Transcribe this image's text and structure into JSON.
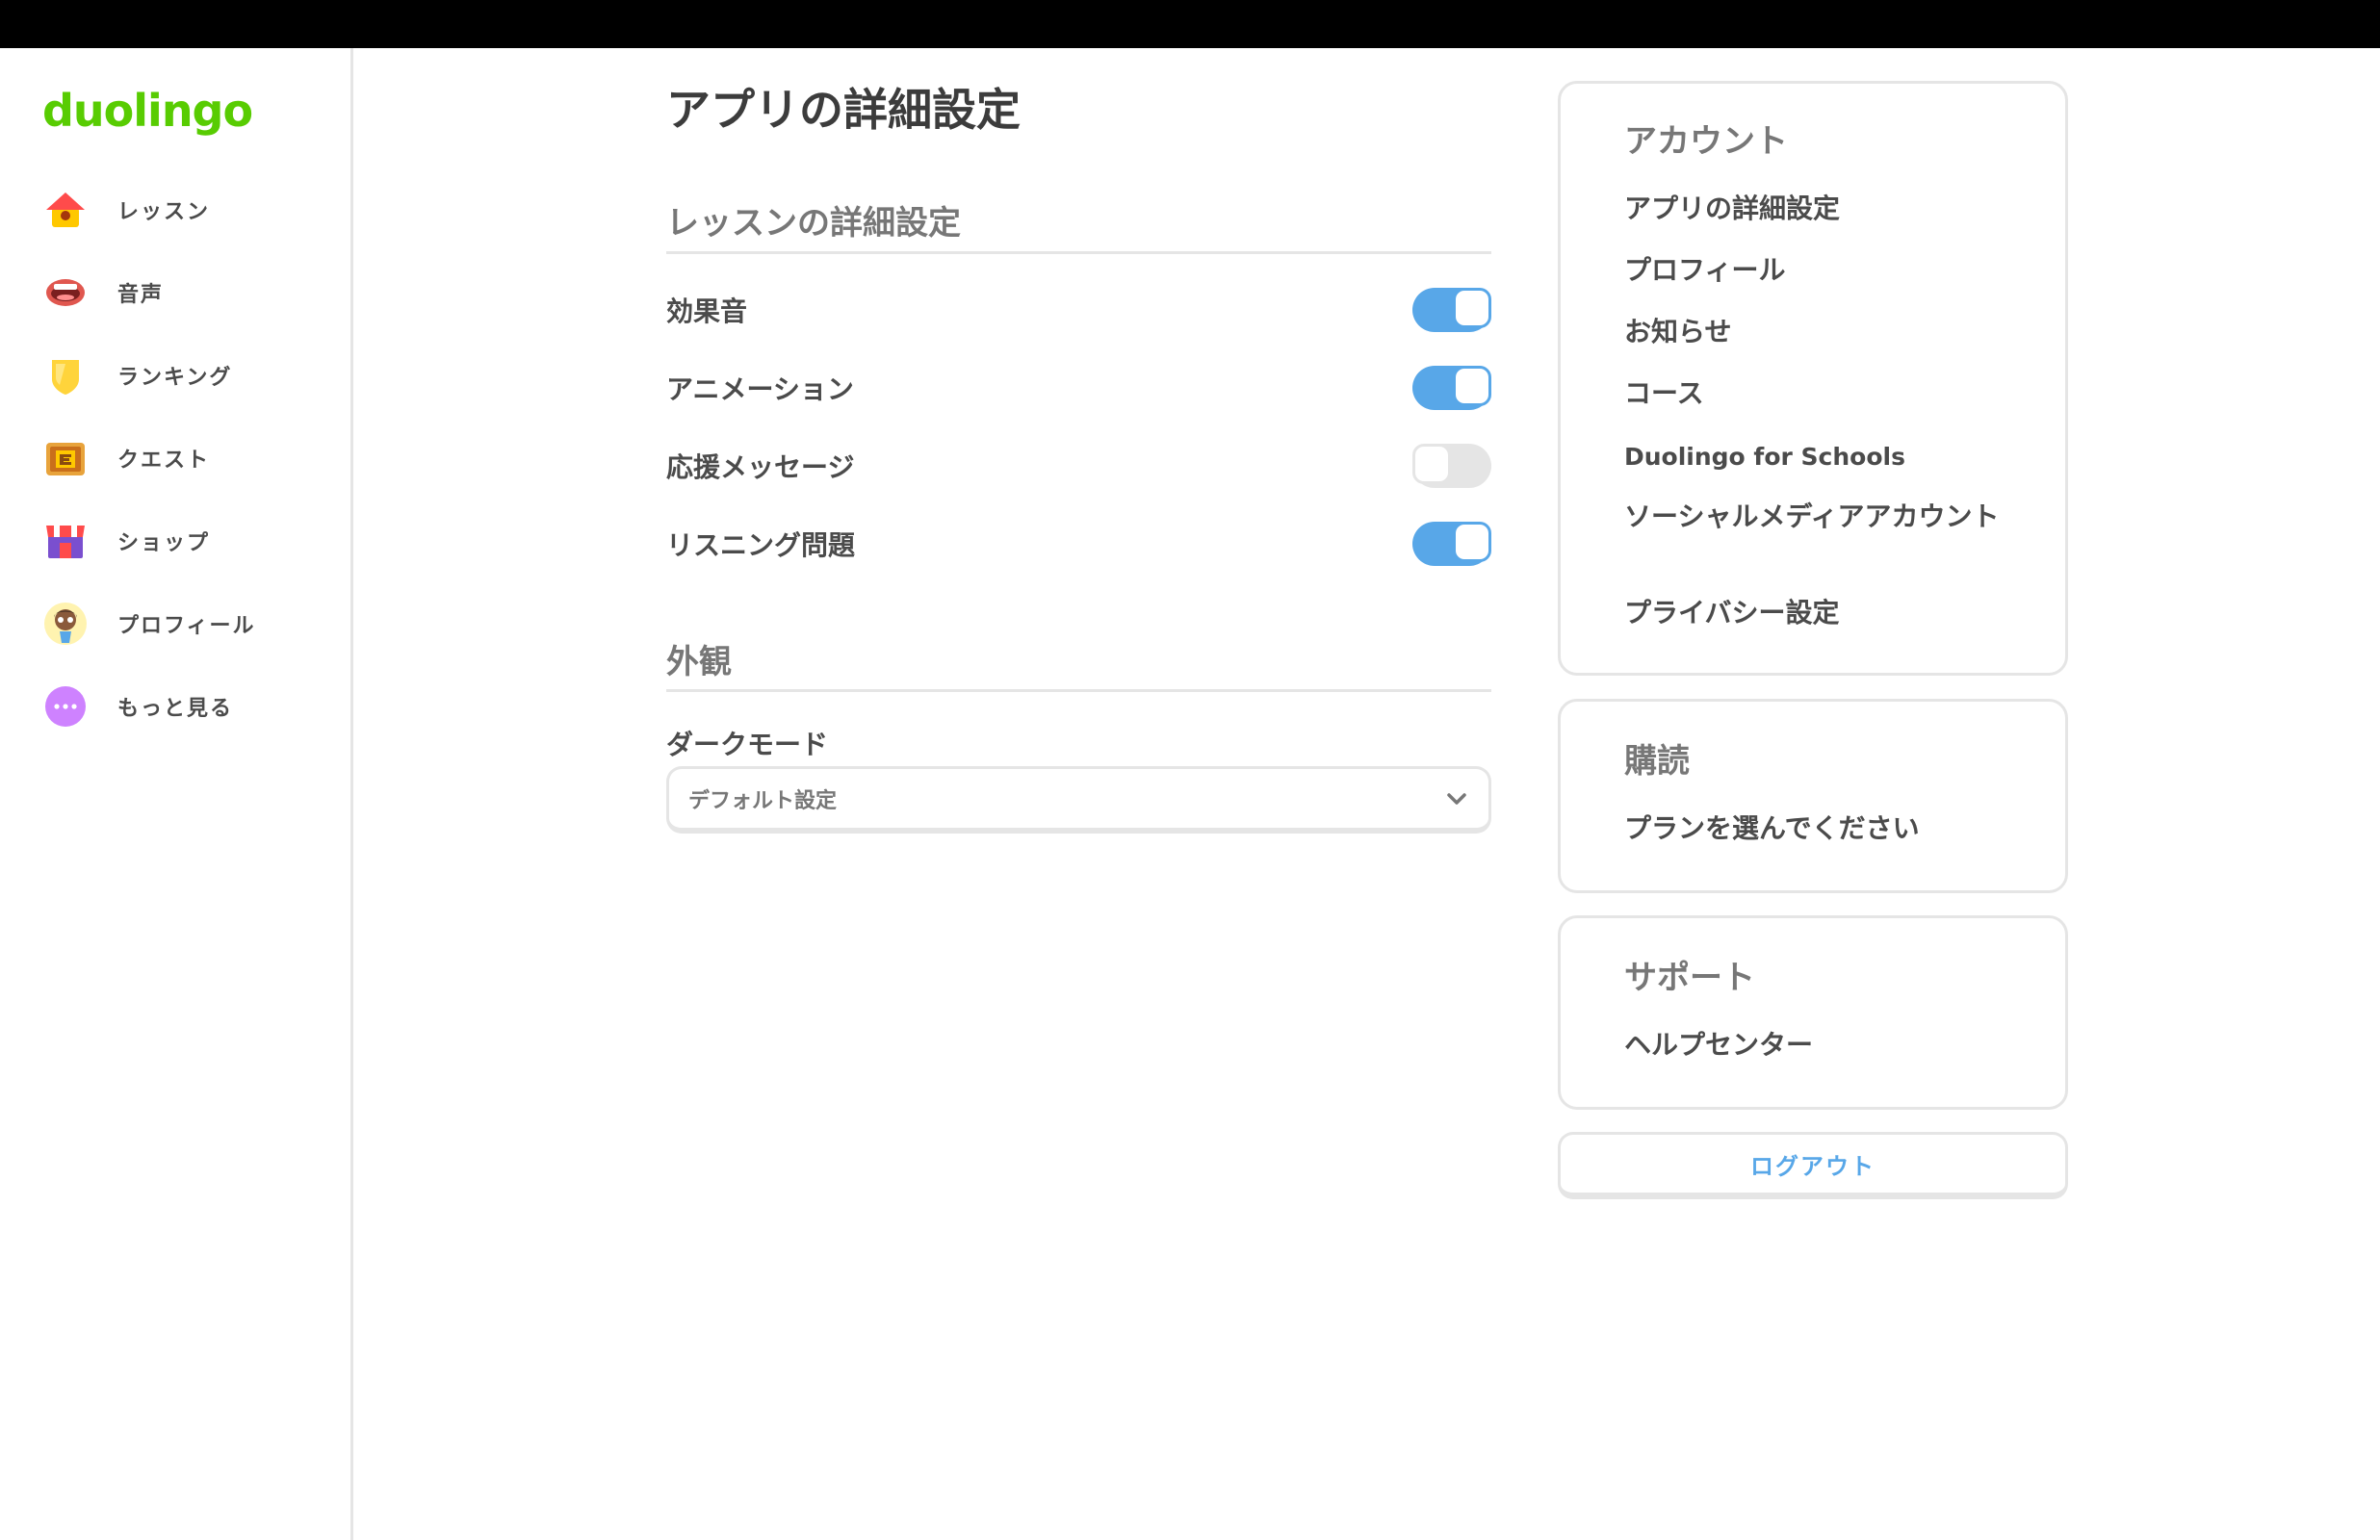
{
  "app": {
    "logo_text": "duolingo"
  },
  "sidebar": {
    "items": [
      {
        "label": "レッスン",
        "icon": "home-icon"
      },
      {
        "label": "音声",
        "icon": "mouth-icon"
      },
      {
        "label": "ランキング",
        "icon": "shield-icon"
      },
      {
        "label": "クエスト",
        "icon": "treasure-chest-icon"
      },
      {
        "label": "ショップ",
        "icon": "shop-icon"
      },
      {
        "label": "プロフィール",
        "icon": "avatar-icon"
      },
      {
        "label": "もっと見る",
        "icon": "more-icon"
      }
    ]
  },
  "main": {
    "title": "アプリの詳細設定",
    "lesson_section": {
      "title": "レッスンの詳細設定",
      "toggles": [
        {
          "label": "効果音",
          "on": true
        },
        {
          "label": "アニメーション",
          "on": true
        },
        {
          "label": "応援メッセージ",
          "on": false
        },
        {
          "label": "リスニング問題",
          "on": true
        }
      ]
    },
    "appearance_section": {
      "title": "外観",
      "dark_mode_label": "ダークモード",
      "dark_mode_value": "デフォルト設定"
    }
  },
  "right": {
    "account": {
      "title": "アカウント",
      "links": [
        "アプリの詳細設定",
        "プロフィール",
        "お知らせ",
        "コース",
        "Duolingo for Schools",
        "ソーシャルメディアアカウント",
        "プライバシー設定"
      ]
    },
    "subscription": {
      "title": "購読",
      "links": [
        "プランを選んでください"
      ]
    },
    "support": {
      "title": "サポート",
      "links": [
        "ヘルプセンター"
      ]
    },
    "logout_label": "ログアウト"
  },
  "colors": {
    "brand_green": "#58cc02",
    "toggle_blue": "#58a7e8",
    "border": "#e5e5e5"
  }
}
